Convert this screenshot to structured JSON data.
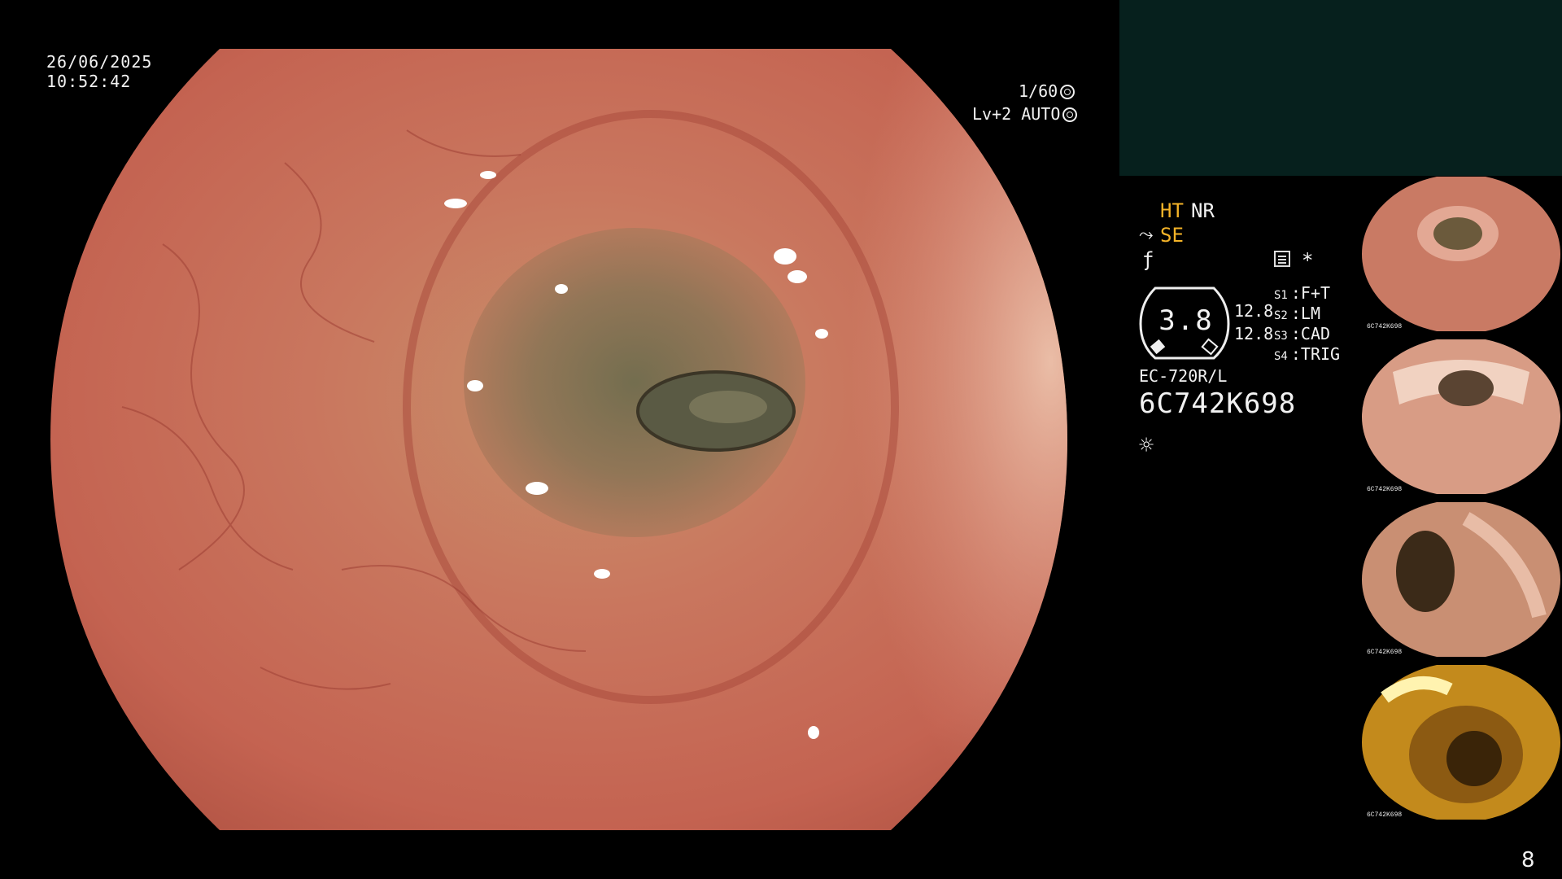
{
  "overlay": {
    "date": "26/06/2025",
    "time": "10:52:42",
    "shutter": "1/60",
    "level_mode": "Lv+2 AUTO"
  },
  "status": {
    "ht": "HT",
    "nr": "NR",
    "se": "SE",
    "gauge_value": "3.8",
    "value_a": "12.8",
    "value_b": "12.8",
    "s_labels": [
      {
        "key": "S1",
        "value": "F+T"
      },
      {
        "key": "S2",
        "value": "LM"
      },
      {
        "key": "S3",
        "value": "CAD"
      },
      {
        "key": "S4",
        "value": "TRIG"
      }
    ],
    "model": "EC-720R/L",
    "serial": "6C742K698"
  },
  "thumbnails": [
    {
      "label": "6C742K698"
    },
    {
      "label": "6C742K698"
    },
    {
      "label": "6C742K698"
    },
    {
      "label": "6C742K698"
    }
  ],
  "page_number": "8",
  "colors": {
    "amber": "#f4b328",
    "panel_box": "#06201d",
    "mucosa": "#c96c57"
  },
  "icons": [
    "shutter-icon",
    "auto-icon",
    "se-scope-icon",
    "f-curve-icon",
    "memo-icon",
    "star-icon",
    "light-icon"
  ]
}
